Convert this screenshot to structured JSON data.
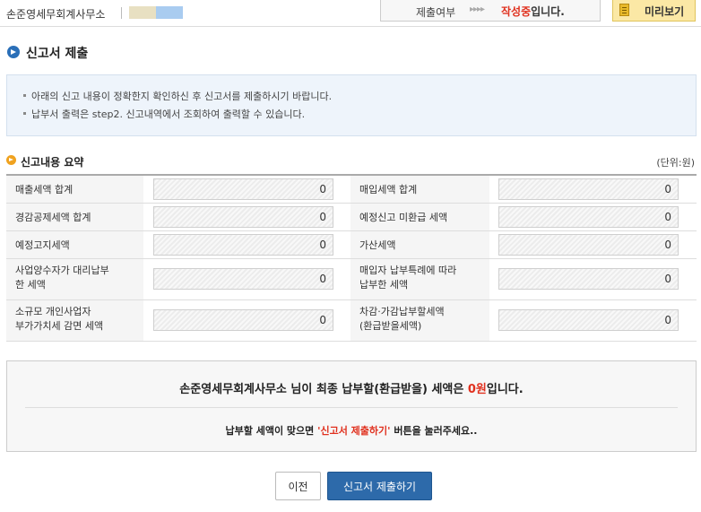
{
  "header": {
    "company": "손준영세무회계사무소",
    "status_label": "제출여부",
    "status_arrows": "▸▸▸▸",
    "status_value_red": "작성중",
    "status_value_rest": "입니다.",
    "preview_label": "미리보기"
  },
  "page": {
    "title": "신고서 제출"
  },
  "notice": {
    "lines": [
      "아래의 신고 내용이 정확한지 확인하신 후 신고서를 제출하시기 바랍니다.",
      "납부서 출력은 step2. 신고내역에서 조회하여 출력할 수 있습니다."
    ]
  },
  "summary": {
    "title": "신고내용 요약",
    "unit": "(단위:원)",
    "rows": [
      {
        "left_label": "매출세액 합계",
        "left_value": "0",
        "right_label": "매입세액 합계",
        "right_value": "0"
      },
      {
        "left_label": "경감공제세액 합계",
        "left_value": "0",
        "right_label": "예정신고 미환급 세액",
        "right_value": "0"
      },
      {
        "left_label": "예정고지세액",
        "left_value": "0",
        "right_label": "가산세액",
        "right_value": "0"
      },
      {
        "left_label": "사업양수자가 대리납부\n한 세액",
        "left_value": "0",
        "right_label": "매입자 납부특례에 따라\n납부한 세액",
        "right_value": "0"
      },
      {
        "left_label": "소규모 개인사업자\n부가가치세 감면 세액",
        "left_value": "0",
        "right_label": "차감·가감납부할세액\n(환급받을세액)",
        "right_value": "0"
      }
    ]
  },
  "result": {
    "main_prefix": "손준영세무회계사무소 님이 최종 납부할(환급받을) 세액은 ",
    "main_amount": "0원",
    "main_suffix": "입니다.",
    "sub_prefix": "납부할 세액이 맞으면 ",
    "sub_highlight": "'신고서 제출하기'",
    "sub_suffix": " 버튼을 눌러주세요.."
  },
  "buttons": {
    "prev": "이전",
    "submit": "신고서 제출하기"
  },
  "colors": {
    "accent_blue": "#2d6aaa",
    "highlight_red": "#e0301e",
    "notice_bg": "#eef4fb",
    "preview_bg": "#fbe8a5"
  }
}
